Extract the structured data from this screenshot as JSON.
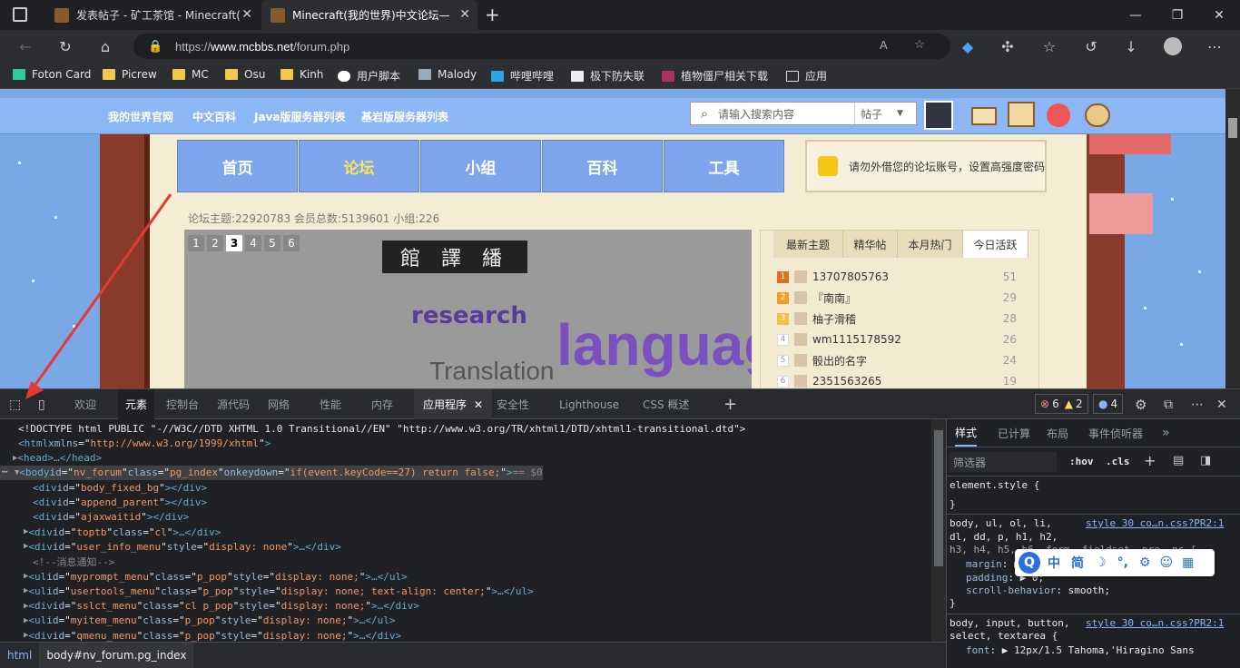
{
  "tabs": [
    {
      "title": "发表帖子 - 矿工茶馆 - Minecraft(",
      "active": false
    },
    {
      "title": "Minecraft(我的世界)中文论坛—",
      "active": true
    }
  ],
  "address": {
    "scheme": "https://",
    "host": "www.mcbbs.net",
    "path": "/forum.php"
  },
  "favorites": [
    "Foton Card",
    "Picrew",
    "MC",
    "Osu",
    "Kinh",
    "用户脚本",
    "Malody",
    "哔哩哔哩",
    "极下防失联",
    "植物僵尸相关下载",
    "应用"
  ],
  "site": {
    "top_links": [
      "我的世界官网",
      "中文百科",
      "Java版服务器列表",
      "基岩版服务器列表"
    ],
    "search_placeholder": "请输入搜索内容",
    "search_scope": "帖子",
    "main_nav": [
      "首页",
      "论坛",
      "小组",
      "百科",
      "工具"
    ],
    "notice": "请勿外借您的论坛账号，设置高强度密码",
    "stats": "论坛主题:22920783   会员总数:5139601   小组:226",
    "banner_pages": [
      "1",
      "2",
      "3",
      "4",
      "5",
      "6"
    ],
    "banner_current": "3",
    "hot_tabs": [
      "最新主题",
      "精华帖",
      "本月热门",
      "今日活跃"
    ],
    "hot_list": [
      {
        "rank": "1",
        "name": "13707805763",
        "count": "51"
      },
      {
        "rank": "2",
        "name": "『南南』",
        "count": "29"
      },
      {
        "rank": "3",
        "name": "柚子滑稽",
        "count": "28"
      },
      {
        "rank": "4",
        "name": "wm1115178592",
        "count": "26"
      },
      {
        "rank": "5",
        "name": "骰出的名字",
        "count": "24"
      },
      {
        "rank": "6",
        "name": "2351563265",
        "count": "19"
      }
    ]
  },
  "devtools": {
    "tabs": [
      "欢迎",
      "元素",
      "控制台",
      "源代码",
      "网络",
      "性能",
      "内存",
      "应用程序",
      "安全性",
      "Lighthouse",
      "CSS 概述"
    ],
    "errors": "6",
    "warnings": "2",
    "info": "4",
    "dom_lines": [
      {
        "t": "doctype",
        "text": "<!DOCTYPE html PUBLIC \"-//W3C//DTD XHTML 1.0 Transitional//EN\" \"http://www.w3.org/TR/xhtml1/DTD/xhtml1-transitional.dtd\">"
      },
      {
        "t": "open",
        "tag": "html",
        "attrs": [
          [
            "xmlns",
            "http://www.w3.org/1999/xhtml"
          ]
        ]
      },
      {
        "t": "collapsed",
        "tag": "head"
      },
      {
        "t": "body",
        "tag": "body",
        "attrs": [
          [
            "id",
            "nv_forum"
          ],
          [
            "class",
            "pg_index"
          ],
          [
            "onkeydown",
            "if(event.keyCode==27) return false;"
          ]
        ],
        "suffix": "== $0"
      },
      {
        "t": "empty",
        "tag": "div",
        "attrs": [
          [
            "id",
            "body_fixed_bg"
          ]
        ]
      },
      {
        "t": "empty",
        "tag": "div",
        "attrs": [
          [
            "id",
            "append_parent"
          ]
        ]
      },
      {
        "t": "empty",
        "tag": "div",
        "attrs": [
          [
            "id",
            "ajaxwaitid"
          ]
        ]
      },
      {
        "t": "collapsed",
        "tag": "div",
        "attrs": [
          [
            "id",
            "toptb"
          ],
          [
            "class",
            "cl"
          ]
        ]
      },
      {
        "t": "collapsed",
        "tag": "div",
        "attrs": [
          [
            "id",
            "user_info_menu"
          ],
          [
            "style",
            "display: none"
          ]
        ]
      },
      {
        "t": "comment",
        "text": "<!--消息通知-->"
      },
      {
        "t": "collapsed",
        "tag": "ul",
        "attrs": [
          [
            "id",
            "myprompt_menu"
          ],
          [
            "class",
            "p_pop"
          ],
          [
            "style",
            "display: none;"
          ]
        ]
      },
      {
        "t": "collapsed",
        "tag": "ul",
        "attrs": [
          [
            "id",
            "usertools_menu"
          ],
          [
            "class",
            "p_pop"
          ],
          [
            "style",
            "display: none; text-align: center;"
          ]
        ]
      },
      {
        "t": "collapsed",
        "tag": "div",
        "attrs": [
          [
            "id",
            "sslct_menu"
          ],
          [
            "class",
            "cl p_pop"
          ],
          [
            "style",
            "display: none;"
          ]
        ]
      },
      {
        "t": "collapsed",
        "tag": "ul",
        "attrs": [
          [
            "id",
            "myitem_menu"
          ],
          [
            "class",
            "p_pop"
          ],
          [
            "style",
            "display: none;"
          ]
        ]
      },
      {
        "t": "collapsed",
        "tag": "div",
        "attrs": [
          [
            "id",
            "qmenu_menu"
          ],
          [
            "class",
            "p_pop "
          ],
          [
            "style",
            "display: none;"
          ]
        ]
      }
    ],
    "breadcrumb": [
      "html",
      "body#nv_forum.pg_index"
    ],
    "styles_tabs": [
      "样式",
      "已计算",
      "布局",
      "事件侦听器"
    ],
    "filter_placeholder": "筛选器",
    "hov": ":hov",
    "cls": ".cls",
    "rules": [
      {
        "selector": "element.style {",
        "close": "}"
      },
      {
        "selector": "body, ul, ol, li,",
        "link": "style 30 co…n.css?PR2:1",
        "more": "dl, dd, p, h1, h2,",
        "more2": "h3, h4, h5, h6, form, fieldset, pre, pc {",
        "props": [
          [
            "margin",
            "0"
          ],
          [
            "padding",
            "0"
          ],
          [
            "scroll-behavior",
            "smooth"
          ]
        ]
      },
      {
        "selector": "body, input, button,",
        "link": "style 30 co…n.css?PR2:1",
        "more": "select, textarea {",
        "props": [
          [
            "font",
            "12px/1.5 Tahoma,'Hiragino Sans"
          ]
        ]
      }
    ],
    "ime": [
      "中",
      "简",
      "☽",
      "°,",
      "⚙",
      "☺",
      "▦"
    ]
  }
}
